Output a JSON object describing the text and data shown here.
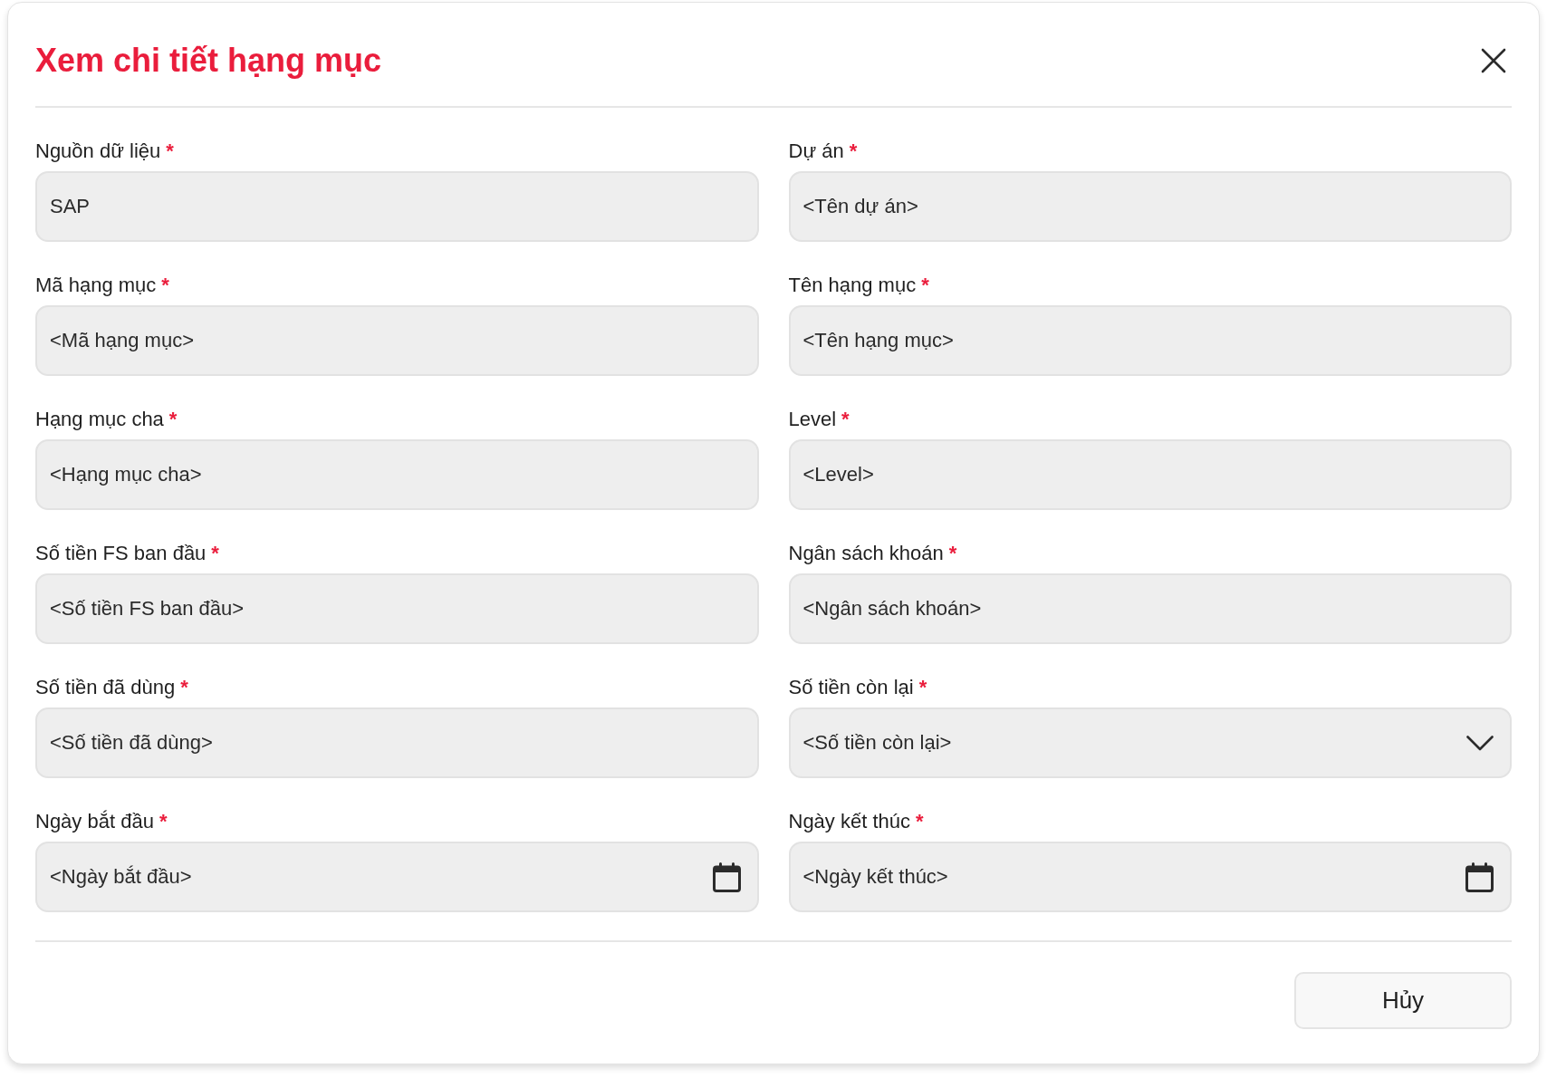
{
  "dialog": {
    "title": "Xem chi tiết hạng mục"
  },
  "fields": [
    {
      "label": "Nguồn dữ liệu",
      "required_mark": "*",
      "kind": "text",
      "value": "SAP"
    },
    {
      "label": "Dự án",
      "required_mark": "*",
      "kind": "text",
      "value": "<Tên dự án>"
    },
    {
      "label": "Mã hạng mục",
      "required_mark": "*",
      "kind": "text",
      "value": "<Mã hạng mục>"
    },
    {
      "label": "Tên hạng mục",
      "required_mark": "*",
      "kind": "text",
      "value": "<Tên hạng mục>"
    },
    {
      "label": "Hạng mục cha",
      "required_mark": "*",
      "kind": "text",
      "value": "<Hạng mục cha>"
    },
    {
      "label": "Level",
      "required_mark": "*",
      "kind": "text",
      "value": "<Level>"
    },
    {
      "label": "Số tiền FS ban đầu",
      "required_mark": "*",
      "kind": "text",
      "value": "<Số tiền FS ban đầu>"
    },
    {
      "label": "Ngân sách khoán",
      "required_mark": "*",
      "kind": "text",
      "value": "<Ngân sách khoán>"
    },
    {
      "label": "Số tiền đã dùng",
      "required_mark": "*",
      "kind": "text",
      "value": "<Số tiền đã dùng>"
    },
    {
      "label": "Số tiền còn lại",
      "required_mark": "*",
      "kind": "select",
      "value": "<Số tiền còn lại>"
    },
    {
      "label": "Ngày bắt đầu",
      "required_mark": "*",
      "kind": "date",
      "value": "<Ngày bắt đầu>"
    },
    {
      "label": "Ngày kết thúc",
      "required_mark": "*",
      "kind": "date",
      "value": "<Ngày kết thúc>"
    }
  ],
  "buttons": [
    {
      "label": "Hủy"
    }
  ]
}
